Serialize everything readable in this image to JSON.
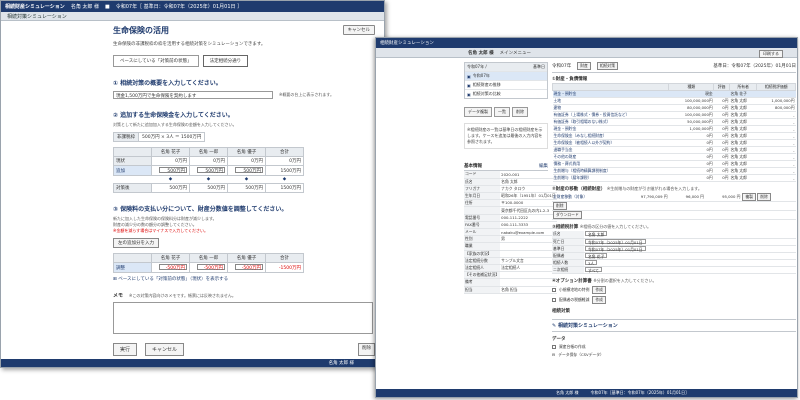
{
  "left": {
    "app_title": "相続財産シミュレーション",
    "user": "名角 太郎 様",
    "header_info": "令和07年［ 基準日：令和07年（2025年）01月01日 ］",
    "sub_title": "相続対策シミュレーション",
    "page_title": "生命保険の活用",
    "cancel_top": "キャンセル",
    "description": "生命保険の非課税枠の枠を活用する相続対策をシミュレーションできます。",
    "tab_current": "ベースにしている「対策前の状態」",
    "tab_after": "法定相続分通り",
    "sec1_title": "① 相続対策の概要を入力してください。",
    "sec1_input": "現金1,500万円で生命保険を契約します",
    "sec1_note": "※概要の台上に表示されます。",
    "sec2_title": "② 追加する生命保険金を入力してください。",
    "sec2_desc": "対策として新たに追加加入する生命保険の金額を入力してください。",
    "exempt_label": "非課税枠",
    "exempt_value": "500万円 × 3人 ＝ 1500万円",
    "grid_headers": [
      "",
      "名角 花子",
      "名角 一郎",
      "名角 優子",
      "合計"
    ],
    "grid_rows": [
      {
        "label": "現状",
        "values": [
          "0万円",
          "0万円",
          "0万円",
          "0万円"
        ]
      },
      {
        "label": "追加",
        "values": [
          "500万円",
          "500万円",
          "500万円",
          "1500万円"
        ]
      },
      {
        "label": "対策後",
        "values": [
          "500万円",
          "500万円",
          "500万円",
          "1500万円"
        ]
      }
    ],
    "sec3_title": "③ 保険料の支払い分について、財産分数値を調整してください。",
    "sec3_desc1": "新たに加入した生命保険の保険料分は財産が減少します。",
    "sec3_desc2": "財産の減少分の数の額分の調整してください。",
    "sec3_red": "※金額を減らす場合はマイナスで入力してください。",
    "apply_btn": "左の追加分を入力",
    "adjust_headers": [
      "",
      "名角 花子",
      "名角 一郎",
      "名角 優子",
      "合計"
    ],
    "adjust_label": "調整",
    "adjust_values": [
      "-500万円",
      "-500万円",
      "-500万円",
      "-1500万円"
    ],
    "link_text": "ベースにしている「対策前の状態」（現状）を表示する",
    "memo_label": "メモ",
    "memo_note": "※この対策内容向けのメモです。帳票には反映されません。",
    "exec_btn": "実行",
    "cancel_btn": "キャンセル",
    "delete_btn": "削除",
    "footer_user": "名角 太郎 様"
  },
  "right": {
    "app_title": "相続財産シミュレーション",
    "user": "名角 太郎 様",
    "menu": "メインメニュー",
    "print_btn": "印刷する",
    "list_header": "令和07年 /",
    "list_header_right": "基準日",
    "list_items": [
      "令和07年",
      "相続財産の推移",
      "相続対策の比較"
    ],
    "tabs": [
      "データ複製",
      "一覧",
      "削除"
    ],
    "note": "※相続財産の一覧は基準日の相続財産を示します。ケースを追加は最後の入力内容を参照されます。",
    "basic_title": "基本情報",
    "basic_edit": "編集",
    "basic_rows": [
      [
        "コード",
        "2020-001"
      ],
      [
        "氏名",
        "名角 太郎"
      ],
      [
        "フリガナ",
        "ナカク タロウ"
      ],
      [
        "生年月日",
        "昭和26年（1951年）01月01日"
      ],
      [
        "住所",
        "〒100-0000"
      ],
      [
        "",
        "東京都千代田区丸の内1-2-3"
      ],
      [
        "電話番号",
        "000-111-2222"
      ],
      [
        "FAX番号",
        "000-111-3333"
      ],
      [
        "メール",
        "nakaku@example.com"
      ],
      [
        "性別",
        "男"
      ],
      [
        "職業",
        ""
      ],
      [
        "【家族の状況】",
        ""
      ],
      [
        "法定相続分数",
        "サンプル文言"
      ],
      [
        "法定相続人",
        "法定相続人"
      ],
      [
        "【その他補足状況】",
        ""
      ],
      [
        "備考",
        ""
      ],
      [
        "担当",
        "名角 担当"
      ]
    ],
    "case_label": "令和07年",
    "case_tabs": [
      "財産",
      "相続対策"
    ],
    "date": "基準日：令和07年（2025年）01月01日",
    "sec1": "①財産・負債情報",
    "asset_headers": [
      "",
      "種類",
      "評価",
      "所有者",
      "相続税評価額"
    ],
    "asset_rows": [
      [
        "現金・預貯金",
        "現金",
        "",
        "名角 花子",
        ""
      ],
      [
        "土地",
        "100,000,000円",
        "0円",
        "名角 太郎",
        "1,000,000円"
      ],
      [
        "建物",
        "80,000,000円",
        "0円",
        "名角 太郎",
        "800,000円"
      ],
      [
        "有価証券（上場株式・債券・投資信託など）",
        "100,000,000円",
        "0円",
        "名角 太郎",
        "-"
      ],
      [
        "有価証券（取引相場のない株式）",
        "50,000,000円",
        "0円",
        "名角 太郎",
        "-"
      ],
      [
        "現金・預貯金",
        "1,000,000円",
        "0円",
        "名角 太郎",
        "-"
      ],
      [
        "生命保険金（みなし相続財産）",
        "0円",
        "0円",
        "名角 太郎",
        "-"
      ],
      [
        "生命保険金（被相続人以外が契約）",
        "0円",
        "0円",
        "名角 太郎",
        "-"
      ],
      [
        "退職手当金",
        "0円",
        "0円",
        "名角 太郎",
        "-"
      ],
      [
        "その他の財産",
        "0円",
        "0円",
        "名角 太郎",
        "-"
      ],
      [
        "債務・葬式費用",
        "0円",
        "0円",
        "名角 太郎",
        "-"
      ],
      [
        "生前贈与（相続時精算課税制度）",
        "0円",
        "0円",
        "名角 太郎",
        "-"
      ],
      [
        "生前贈与（暦年課税）",
        "0円",
        "0円",
        "名角 太郎",
        "-"
      ]
    ],
    "sec2": "②財産の移動（相続財産）",
    "sec2_note": "※生前贈与の財産が引き継がれる場合を入力します。",
    "move_row": [
      "全財産移動（対象）",
      "97,790,009 円",
      "96,000 円",
      "95,000 円"
    ],
    "move_btns": [
      "複製",
      "削除"
    ],
    "del_btn": "削除",
    "down_btn": "ダウンロード",
    "sec3": "③相続税計算",
    "sec3_note": "※相続の区分の値を入力してください。",
    "form_rows": [
      [
        "氏名",
        "名角 太郎"
      ],
      [
        "死亡日",
        "令和07年（2025年）01月01日"
      ],
      [
        "基準日",
        "令和07年（2025年）01月01日"
      ],
      [
        "配偶者",
        "名角 花子"
      ],
      [
        "相続人数",
        "3人"
      ],
      [
        "二次相続",
        "すべて"
      ]
    ],
    "opt_heading": "④オプション計算書",
    "opt_note": "※分割の選択を入力してください。",
    "opt_rows": [
      "小規模宅地の特例",
      "配偶者の税額軽減"
    ],
    "opt_btn": "作成",
    "sim_heading": "相続対策",
    "sim_link": "相続対策シミュレーション",
    "doc_heading": "データ",
    "doc_rows": [
      "資産台帳の作成",
      "データ保存（CSVデータ）"
    ],
    "footer_user": "名角 太郎 様",
    "footer_year": "令和07年［基準日：令和07年（2025年）01月01日］"
  }
}
